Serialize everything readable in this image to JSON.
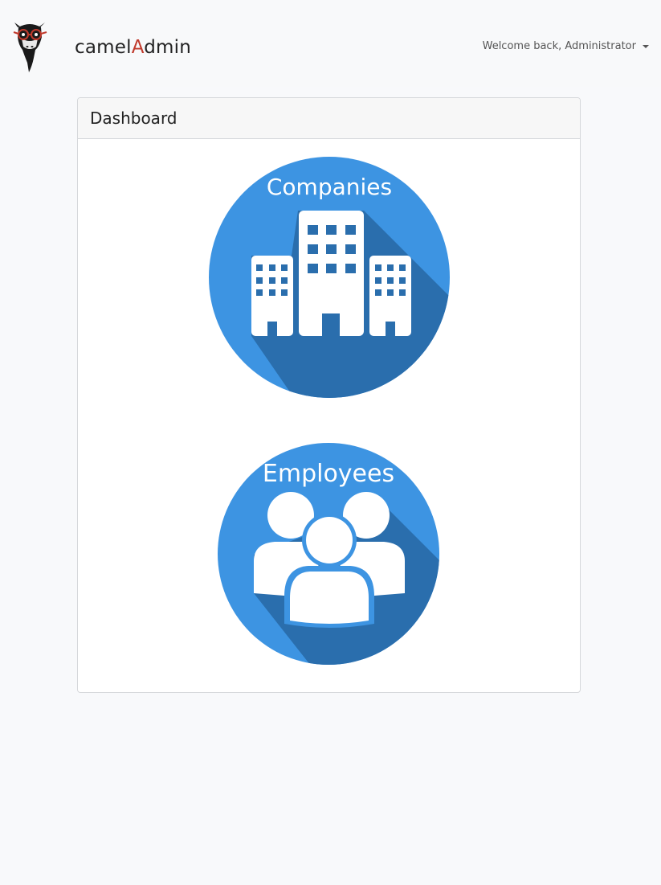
{
  "navbar": {
    "brand_prefix": "camel",
    "brand_accent": "A",
    "brand_suffix": "dmin",
    "user_greeting": "Welcome back, Administrator"
  },
  "dashboard": {
    "title": "Dashboard",
    "tiles": [
      {
        "label": "Companies",
        "icon": "buildings-icon"
      },
      {
        "label": "Employees",
        "icon": "people-group-icon"
      }
    ]
  },
  "colors": {
    "tile_blue": "#3d94e2",
    "tile_shadow": "#2a6ead",
    "brand_accent": "#c0392b"
  }
}
